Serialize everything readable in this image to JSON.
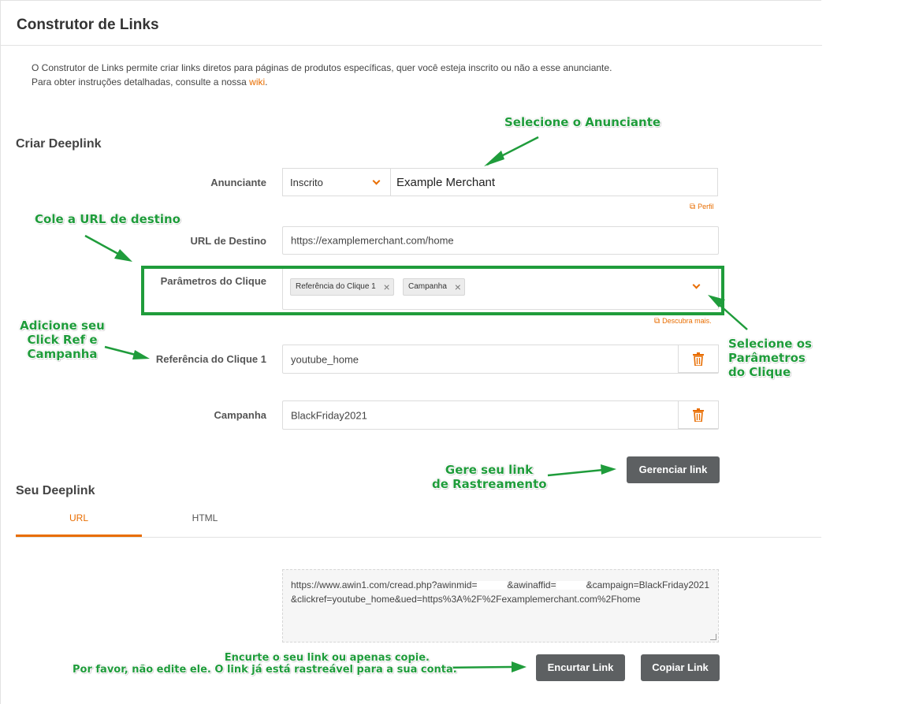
{
  "header": {
    "title": "Construtor de Links"
  },
  "intro": {
    "line1": "O Construtor de Links permite criar links diretos para páginas de produtos específicas, quer você esteja inscrito ou não a esse anunciante.",
    "line2_prefix": "Para obter instruções detalhadas, consulte a nossa ",
    "line2_link": "wiki",
    "line2_suffix": "."
  },
  "create_section": {
    "title": "Criar Deeplink",
    "advertiser_label": "Anunciante",
    "advertiser_filter": "Inscrito",
    "advertiser_value": "Example Merchant",
    "profile_link": "Perfil",
    "destination_label": "URL de Destino",
    "destination_value": "https://examplemerchant.com/home",
    "click_params_label": "Parâmetros do Clique",
    "click_param_tags": [
      "Referência do Clique 1",
      "Campanha"
    ],
    "discover_link": "Descubra mais.",
    "clickref_label": "Referência do Clique 1",
    "clickref_value": "youtube_home",
    "campaign_label": "Campanha",
    "campaign_value": "BlackFriday2021",
    "generate_button": "Gerenciar link"
  },
  "result_section": {
    "title": "Seu Deeplink",
    "tabs": [
      "URL",
      "HTML"
    ],
    "active_tab": "URL",
    "link_part1": "https://www.awin1.com/cread.php?awinmid=",
    "link_part2": "&awinaffid=",
    "link_part3": "&campaign=BlackFriday2021&clickref=youtube_home&ued=https%3A%2F%2Fexamplemerchant.com%2Fhome",
    "shorten_button": "Encurtar Link",
    "copy_button": "Copiar Link"
  },
  "annotations": {
    "select_advertiser": "Selecione o Anunciante",
    "paste_url": "Cole a URL de destino",
    "add_clickref_1": "Adicione seu",
    "add_clickref_2": "Click Ref e",
    "add_clickref_3": "Campanha",
    "select_params_1": "Selecione os",
    "select_params_2": "Parâmetros",
    "select_params_3": "do Clique",
    "generate_1": "Gere seu link",
    "generate_2": "de Rastreamento",
    "shorten_1": "Encurte o seu link ou apenas copie.",
    "shorten_2": "Por favor, não edite ele. O link já está rastreável para a sua conta."
  },
  "colors": {
    "accent": "#e86d00",
    "annotation_green": "#1f9c3b",
    "button_gray": "#5d6062"
  }
}
